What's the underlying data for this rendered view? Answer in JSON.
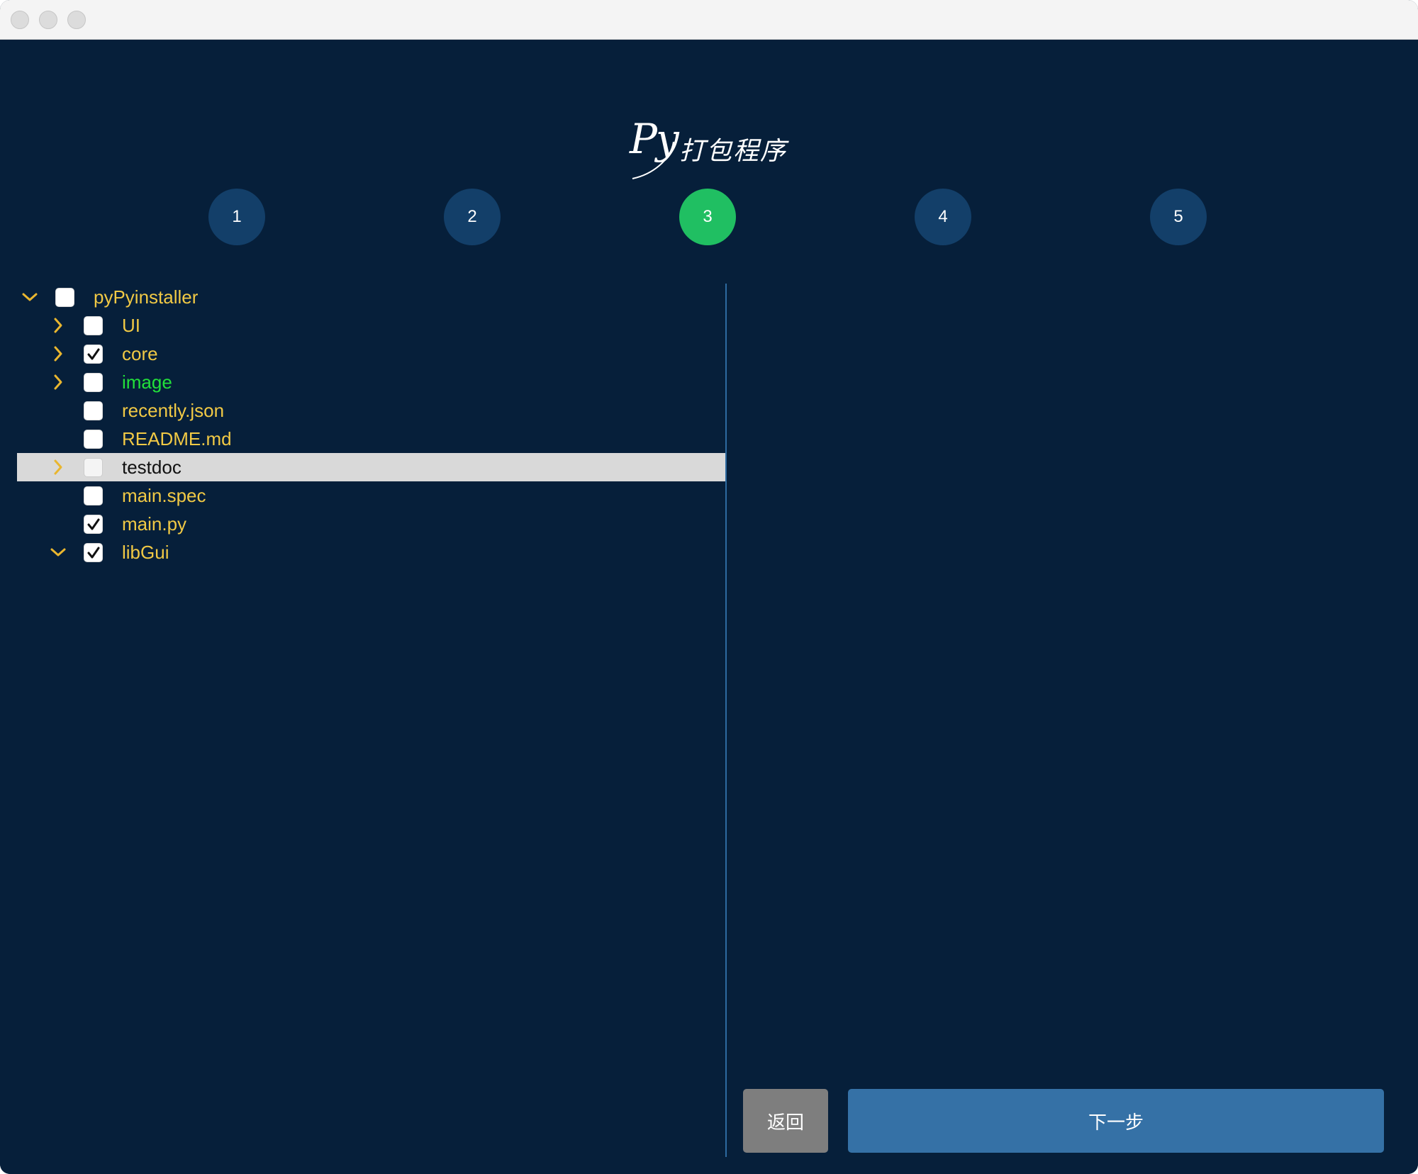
{
  "window": {
    "title": ""
  },
  "header": {
    "logo_py": "Py",
    "logo_text": "打包程序"
  },
  "steps": [
    {
      "label": "1",
      "active": false
    },
    {
      "label": "2",
      "active": false
    },
    {
      "label": "3",
      "active": true
    },
    {
      "label": "4",
      "active": false
    },
    {
      "label": "5",
      "active": false
    }
  ],
  "tree": {
    "items": [
      {
        "label": "pyPyinstaller",
        "level": 0,
        "expander": "expanded",
        "checked": false,
        "selected": false,
        "color": "yellow"
      },
      {
        "label": "UI",
        "level": 1,
        "expander": "collapsed",
        "checked": false,
        "selected": false,
        "color": "yellow"
      },
      {
        "label": "core",
        "level": 1,
        "expander": "collapsed",
        "checked": true,
        "selected": false,
        "color": "yellow"
      },
      {
        "label": "image",
        "level": 1,
        "expander": "collapsed",
        "checked": false,
        "selected": false,
        "color": "green"
      },
      {
        "label": "recently.json",
        "level": 1,
        "expander": "none",
        "checked": false,
        "selected": false,
        "color": "yellow"
      },
      {
        "label": "README.md",
        "level": 1,
        "expander": "none",
        "checked": false,
        "selected": false,
        "color": "yellow"
      },
      {
        "label": "testdoc",
        "level": 1,
        "expander": "collapsed",
        "checked": false,
        "selected": true,
        "color": "yellow"
      },
      {
        "label": "main.spec",
        "level": 1,
        "expander": "none",
        "checked": false,
        "selected": false,
        "color": "yellow"
      },
      {
        "label": "main.py",
        "level": 1,
        "expander": "none",
        "checked": true,
        "selected": false,
        "color": "yellow"
      },
      {
        "label": "libGui",
        "level": 1,
        "expander": "expanded",
        "checked": true,
        "selected": false,
        "color": "yellow"
      }
    ]
  },
  "buttons": {
    "back_label": "返回",
    "next_label": "下一步"
  },
  "colors": {
    "background": "#061f3a",
    "step_inactive": "#133f69",
    "step_active": "#20bf62",
    "tree_text": "#f1c945",
    "tree_text_green": "#22e03a",
    "chevron": "#e9b62f",
    "divider": "#2d6aa0",
    "back_button": "#7e7e7e",
    "next_button": "#3571a6"
  }
}
